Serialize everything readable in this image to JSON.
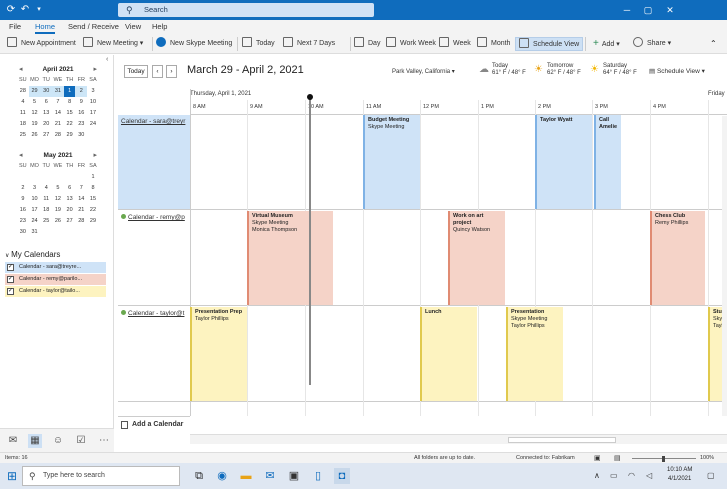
{
  "titlebar": {
    "search_placeholder": "Search"
  },
  "menu": [
    "File",
    "Home",
    "Send / Receive",
    "View",
    "Help"
  ],
  "ribbon": {
    "new_appointment": "New Appointment",
    "new_meeting": "New Meeting",
    "new_skype": "New Skype Meeting",
    "today": "Today",
    "next7": "Next 7 Days",
    "day": "Day",
    "work_week": "Work Week",
    "week": "Week",
    "month": "Month",
    "schedule_view": "Schedule View",
    "add": "Add",
    "share": "Share"
  },
  "minical1": {
    "title": "April 2021",
    "dow": [
      "SU",
      "MO",
      "TU",
      "WE",
      "TH",
      "FR",
      "SA"
    ],
    "weeks": [
      [
        "28",
        "29",
        "30",
        "31",
        "1",
        "2",
        "3"
      ],
      [
        "4",
        "5",
        "6",
        "7",
        "8",
        "9",
        "10"
      ],
      [
        "11",
        "12",
        "13",
        "14",
        "15",
        "16",
        "17"
      ],
      [
        "18",
        "19",
        "20",
        "21",
        "22",
        "23",
        "24"
      ],
      [
        "25",
        "26",
        "27",
        "28",
        "29",
        "30",
        ""
      ]
    ]
  },
  "minical2": {
    "title": "May 2021",
    "dow": [
      "SU",
      "MO",
      "TU",
      "WE",
      "TH",
      "FR",
      "SA"
    ],
    "weeks": [
      [
        "",
        "",
        "",
        "",
        "",
        "",
        "1"
      ],
      [
        "2",
        "3",
        "4",
        "5",
        "6",
        "7",
        "8"
      ],
      [
        "9",
        "10",
        "11",
        "12",
        "13",
        "14",
        "15"
      ],
      [
        "16",
        "17",
        "18",
        "19",
        "20",
        "21",
        "22"
      ],
      [
        "23",
        "24",
        "25",
        "26",
        "27",
        "28",
        "29"
      ],
      [
        "30",
        "31",
        "",
        "",
        "",
        "",
        ""
      ]
    ]
  },
  "my_calendars": {
    "heading": "My Calendars",
    "items": [
      {
        "label": "Calendar - sara@treyre...",
        "color": "#cfe3f7"
      },
      {
        "label": "Calendar - remy@parilo...",
        "color": "#f5d3c8"
      },
      {
        "label": "Calendar - taylor@tailo...",
        "color": "#fdf3c0"
      }
    ]
  },
  "toolbar": {
    "today_btn": "Today",
    "prev": "‹",
    "next": "›",
    "date_range": "March 29 - April 2, 2021",
    "location": "Park Valley, California",
    "weather": [
      {
        "day": "Today",
        "temps": "61° F / 48° F",
        "icon": "cloud-icon"
      },
      {
        "day": "Tomorrow",
        "temps": "62° F / 48° F",
        "icon": "partly-sunny-icon"
      },
      {
        "day": "Saturday",
        "temps": "64° F / 48° F",
        "icon": "sunny-icon"
      }
    ],
    "view_select": "Schedule View"
  },
  "schedule": {
    "day_header": "Thursday, April 1, 2021",
    "day_header_next": "Friday",
    "times": [
      "8 AM",
      "9 AM",
      "10 AM",
      "11 AM",
      "12 PM",
      "1 PM",
      "2 PM",
      "3 PM",
      "4 PM"
    ],
    "lanes": [
      {
        "label": "Calendar - sara@treyr",
        "color": "#cfe3f7"
      },
      {
        "label": "Calendar - remy@p",
        "color": "#f5d3c8"
      },
      {
        "label": "Calendar - taylor@t",
        "color": "#fdf3c0"
      }
    ],
    "events": [
      {
        "title": "Budget Meeting",
        "sub": "Skype Meeting",
        "sub2": ""
      },
      {
        "title": "Taylor Wyatt",
        "sub": "",
        "sub2": ""
      },
      {
        "title": "Call Amelie",
        "sub": "",
        "sub2": ""
      },
      {
        "title": "Virtual Museum",
        "sub": "Skype Meeting",
        "sub2": "Monica Thompson"
      },
      {
        "title": "Work on art project",
        "sub": "Quincy Watson",
        "sub2": ""
      },
      {
        "title": "Chess Club",
        "sub": "Remy Phillips",
        "sub2": ""
      },
      {
        "title": "Presentation Prep",
        "sub": "Taylor Phillips",
        "sub2": ""
      },
      {
        "title": "Lunch",
        "sub": "",
        "sub2": ""
      },
      {
        "title": "Presentation",
        "sub": "Skype Meeting",
        "sub2": "Taylor Phillips"
      },
      {
        "title": "Stud",
        "sub": "Skyp",
        "sub2": "Tayk"
      }
    ],
    "add_calendar": "Add a Calendar"
  },
  "status": {
    "items": "Items: 16",
    "sync": "All folders are up to date.",
    "connected": "Connected to: Fabrikam",
    "zoom": "100%"
  },
  "taskbar": {
    "search_placeholder": "Type here to search",
    "time": "10:10 AM",
    "date": "4/1/2021"
  }
}
